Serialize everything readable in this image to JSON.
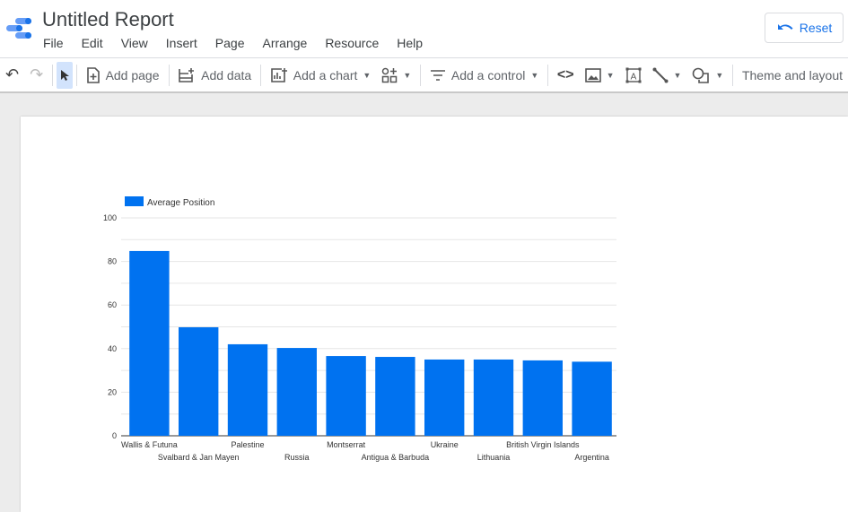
{
  "app": {
    "title": "Untitled Report",
    "reset_label": "Reset"
  },
  "menu": [
    "File",
    "Edit",
    "View",
    "Insert",
    "Page",
    "Arrange",
    "Resource",
    "Help"
  ],
  "toolbar": {
    "add_page": "Add page",
    "add_data": "Add data",
    "add_chart": "Add a chart",
    "add_control": "Add a control",
    "theme": "Theme and layout"
  },
  "colors": {
    "accent": "#1a73e8",
    "bar": "#0072f0"
  },
  "chart_data": {
    "type": "bar",
    "title": "",
    "legend": [
      "Average Position"
    ],
    "legend_position": "top-left",
    "categories": [
      "Wallis & Futuna",
      "Svalbard & Jan Mayen",
      "Palestine",
      "Russia",
      "Montserrat",
      "Antigua & Barbuda",
      "Ukraine",
      "Lithuania",
      "British Virgin Islands",
      "Argentina"
    ],
    "series": [
      {
        "name": "Average Position",
        "values": [
          84.8,
          49.8,
          42,
          40.3,
          36.6,
          36.2,
          35,
          35,
          34.6,
          34
        ]
      }
    ],
    "yticks": [
      0,
      20,
      40,
      60,
      80,
      100
    ],
    "ylim": [
      0,
      100
    ],
    "grid": true,
    "xlabel": "",
    "ylabel": ""
  }
}
